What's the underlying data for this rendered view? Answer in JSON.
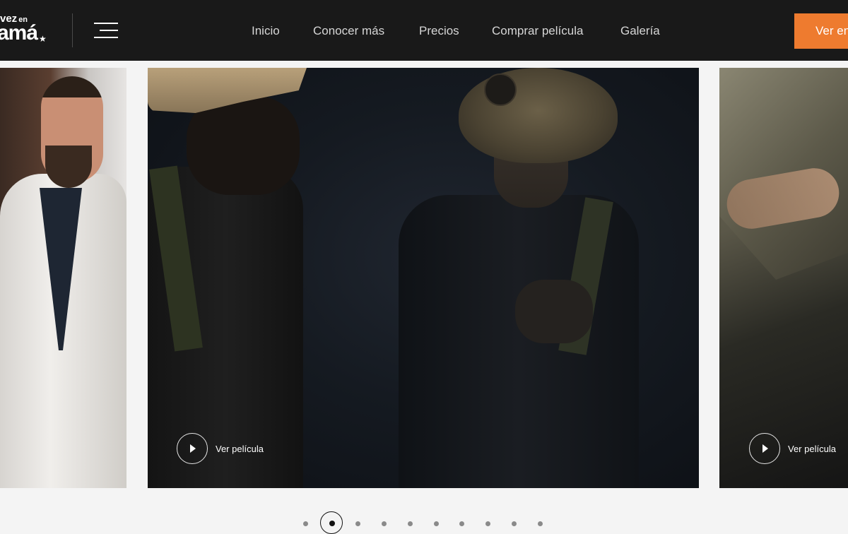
{
  "header": {
    "logo": {
      "top_text": "vez",
      "top_small": "en",
      "main_text": "amá"
    },
    "nav": [
      {
        "label": "Inicio"
      },
      {
        "label": "Conocer más"
      },
      {
        "label": "Precios"
      },
      {
        "label": "Comprar película"
      },
      {
        "label": "Galería"
      }
    ],
    "cta_label": "Ver en"
  },
  "slides": [
    {
      "play_label": ""
    },
    {
      "play_label": "Ver película"
    },
    {
      "play_label": "Ver película"
    }
  ],
  "pagination": {
    "count": 10,
    "active_index": 1
  },
  "colors": {
    "header_bg": "#191919",
    "accent": "#ee7b2f",
    "page_bg": "#f4f4f4"
  },
  "icons": {
    "menu": "hamburger-icon",
    "play": "play-icon",
    "star": "star-icon"
  }
}
